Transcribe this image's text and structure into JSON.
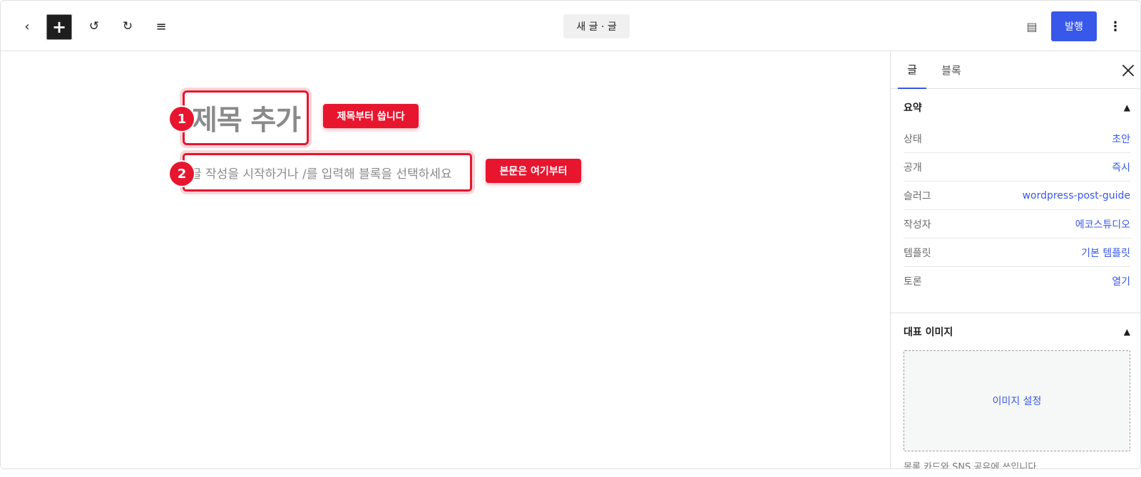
{
  "toolbar": {
    "back_icon": "‹",
    "add_icon": "+",
    "undo_icon": "↺",
    "redo_icon": "↻",
    "list_icon": "≡",
    "doc_title": "새 글 · 글",
    "settings_icon": "▤",
    "publish_label": "발행",
    "more_icon": "⋮"
  },
  "editor": {
    "title_placeholder": "제목 추가",
    "body_placeholder": "글 작성을 시작하거나 /를 입력해 블록을 선택하세요",
    "badge_1": "1",
    "badge_2": "2",
    "callout_1": "제목부터 씁니다",
    "callout_2": "본문은 여기부터",
    "highlight_color": "#e8152f"
  },
  "sidebar": {
    "tabs": [
      {
        "label": "글"
      },
      {
        "label": "블록"
      }
    ],
    "summary": {
      "heading": "요약",
      "toggle_icon": "▲",
      "rows": [
        {
          "label": "상태",
          "value": "초안"
        },
        {
          "label": "공개",
          "value": "즉시"
        },
        {
          "label": "슬러그",
          "value": "wordpress-post-guide"
        },
        {
          "label": "작성자",
          "value": "에코스튜디오"
        },
        {
          "label": "템플릿",
          "value": "기본 템플릿"
        },
        {
          "label": "토론",
          "value": "열기"
        }
      ]
    },
    "featured_image": {
      "heading": "대표 이미지",
      "toggle_icon": "▲",
      "set_label": "이미지 설정",
      "help_text": "목록 카드와 SNS 공유에 쓰입니다."
    }
  },
  "colors": {
    "accent": "#3858e9",
    "annotation": "#e8152f"
  }
}
